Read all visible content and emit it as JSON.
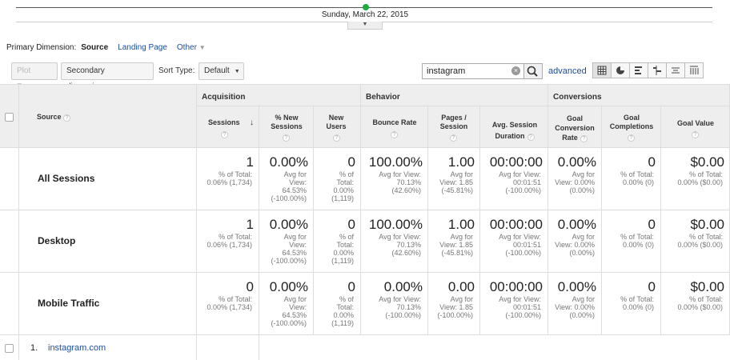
{
  "timeline": {
    "date_label": "Sunday, March 22, 2015"
  },
  "primary_dimension": {
    "label": "Primary Dimension:",
    "active": "Source",
    "links": [
      "Landing Page",
      "Other"
    ]
  },
  "toolbar": {
    "plot_rows": "Plot Rows",
    "secondary_dimension": "Secondary dimension",
    "sort_type_label": "Sort Type:",
    "sort_type_value": "Default",
    "search_value": "instagram",
    "advanced": "advanced"
  },
  "table": {
    "source_header": "Source",
    "groups": {
      "acquisition": "Acquisition",
      "behavior": "Behavior",
      "conversions": "Conversions"
    },
    "columns": [
      {
        "label": "Sessions"
      },
      {
        "label": "% New Sessions"
      },
      {
        "label": "New Users"
      },
      {
        "label": "Bounce Rate"
      },
      {
        "label": "Pages / Session"
      },
      {
        "label": "Avg. Session Duration"
      },
      {
        "label": "Goal Conversion Rate"
      },
      {
        "label": "Goal Completions"
      },
      {
        "label": "Goal Value"
      }
    ],
    "rows": [
      {
        "label": "All Sessions",
        "cells": [
          {
            "main": "1",
            "sub": [
              "% of Total:",
              "0.06% (1,734)"
            ]
          },
          {
            "main": "0.00%",
            "sub": [
              "Avg for",
              "View:",
              "64.53%",
              "(-100.00%)"
            ]
          },
          {
            "main": "0",
            "sub": [
              "% of",
              "Total:",
              "0.00%",
              "(1,119)"
            ]
          },
          {
            "main": "100.00%",
            "sub": [
              "Avg for View:",
              "70.13%",
              "(42.60%)"
            ]
          },
          {
            "main": "1.00",
            "sub": [
              "Avg for",
              "View: 1.85",
              "(-45.81%)"
            ]
          },
          {
            "main": "00:00:00",
            "sub": [
              "Avg for View:",
              "00:01:51",
              "(-100.00%)"
            ]
          },
          {
            "main": "0.00%",
            "sub": [
              "Avg for",
              "View: 0.00%",
              "(0.00%)"
            ]
          },
          {
            "main": "0",
            "sub": [
              "% of Total:",
              "0.00% (0)"
            ]
          },
          {
            "main": "$0.00",
            "sub": [
              "% of Total:",
              "0.00% ($0.00)"
            ]
          }
        ]
      },
      {
        "label": "Desktop",
        "cells": [
          {
            "main": "1",
            "sub": [
              "% of Total:",
              "0.06% (1,734)"
            ]
          },
          {
            "main": "0.00%",
            "sub": [
              "Avg for",
              "View:",
              "64.53%",
              "(-100.00%)"
            ]
          },
          {
            "main": "0",
            "sub": [
              "% of",
              "Total:",
              "0.00%",
              "(1,119)"
            ]
          },
          {
            "main": "100.00%",
            "sub": [
              "Avg for View:",
              "70.13%",
              "(42.60%)"
            ]
          },
          {
            "main": "1.00",
            "sub": [
              "Avg for",
              "View: 1.85",
              "(-45.81%)"
            ]
          },
          {
            "main": "00:00:00",
            "sub": [
              "Avg for View:",
              "00:01:51",
              "(-100.00%)"
            ]
          },
          {
            "main": "0.00%",
            "sub": [
              "Avg for",
              "View: 0.00%",
              "(0.00%)"
            ]
          },
          {
            "main": "0",
            "sub": [
              "% of Total:",
              "0.00% (0)"
            ]
          },
          {
            "main": "$0.00",
            "sub": [
              "% of Total:",
              "0.00% ($0.00)"
            ]
          }
        ]
      },
      {
        "label": "Mobile Traffic",
        "cells": [
          {
            "main": "0",
            "sub": [
              "% of Total:",
              "0.00% (1,734)"
            ]
          },
          {
            "main": "0.00%",
            "sub": [
              "Avg for",
              "View:",
              "64.53%",
              "(-100.00%)"
            ]
          },
          {
            "main": "0",
            "sub": [
              "% of",
              "Total:",
              "0.00%",
              "(1,119)"
            ]
          },
          {
            "main": "0.00%",
            "sub": [
              "Avg for View:",
              "70.13%",
              "(-100.00%)"
            ]
          },
          {
            "main": "0.00",
            "sub": [
              "Avg for",
              "View: 1.85",
              "(-100.00%)"
            ]
          },
          {
            "main": "00:00:00",
            "sub": [
              "Avg for View:",
              "00:01:51",
              "(-100.00%)"
            ]
          },
          {
            "main": "0.00%",
            "sub": [
              "Avg for",
              "View: 0.00%",
              "(0.00%)"
            ]
          },
          {
            "main": "0",
            "sub": [
              "% of Total:",
              "0.00% (0)"
            ]
          },
          {
            "main": "$0.00",
            "sub": [
              "% of Total:",
              "0.00% ($0.00)"
            ]
          }
        ]
      }
    ],
    "data_rows": [
      {
        "index": "1.",
        "source": "instagram.com"
      }
    ]
  },
  "colors": {
    "link": "#1a4ea1",
    "accent_dot": "#1eaa3c",
    "header_bg": "#eeeeee"
  }
}
